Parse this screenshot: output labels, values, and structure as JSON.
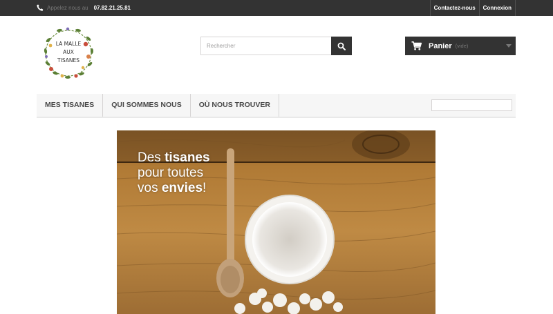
{
  "topbar": {
    "phone_label": "Appelez nous au",
    "phone_number": "07.82.21.25.81",
    "links": [
      "Contactez-nous",
      "Connexion"
    ]
  },
  "logo": {
    "line1": "LA MALLE",
    "line2": "AUX",
    "line3": "TISANES"
  },
  "search": {
    "placeholder": "Rechercher"
  },
  "cart": {
    "label": "Panier",
    "status": "(vide)"
  },
  "menu": {
    "items": [
      "MES TISANES",
      "QUI SOMMES NOUS",
      "OÙ NOUS TROUVER"
    ]
  },
  "hero": {
    "line1_a": "Des ",
    "line1_b": "tisanes",
    "line2": "pour toutes",
    "line3_a": "vos ",
    "line3_b": "envies",
    "line3_c": "!"
  },
  "colors": {
    "topbar_bg": "#333333",
    "menu_bg": "#f6f6f6",
    "text_dark": "#484848"
  },
  "icons": [
    "phone-icon",
    "search-icon",
    "cart-icon",
    "chevron-down-icon"
  ]
}
